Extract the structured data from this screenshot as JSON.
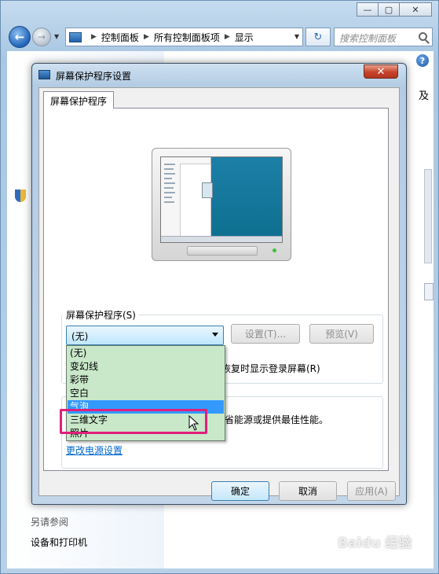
{
  "explorer": {
    "address": {
      "crumbs": [
        "控制面板",
        "所有控制面板项",
        "显示"
      ]
    },
    "search_placeholder": "搜索控制面板",
    "right_cut_text": "及",
    "see_also": "另请参阅",
    "devices_link": "设备和打印机"
  },
  "dialog": {
    "title": "屏幕保护程序设置",
    "tab": "屏幕保护程序",
    "screensaver_group_label": "屏幕保护程序(S)",
    "combo_value": "(无)",
    "settings_button": "设置(T)...",
    "preview_button": "预览(V)",
    "resume_text": "恢复时显示登录屏幕(R)",
    "power_text": "省能源或提供最佳性能。",
    "power_link": "更改电源设置",
    "dropdown_items": [
      "(无)",
      "变幻线",
      "彩带",
      "空白",
      "气泡",
      "三维文字",
      "照片"
    ],
    "selected_item_index": 4,
    "ok_button": "确定",
    "cancel_button": "取消",
    "apply_button": "应用(A)"
  },
  "watermark": "Baidu 经验"
}
